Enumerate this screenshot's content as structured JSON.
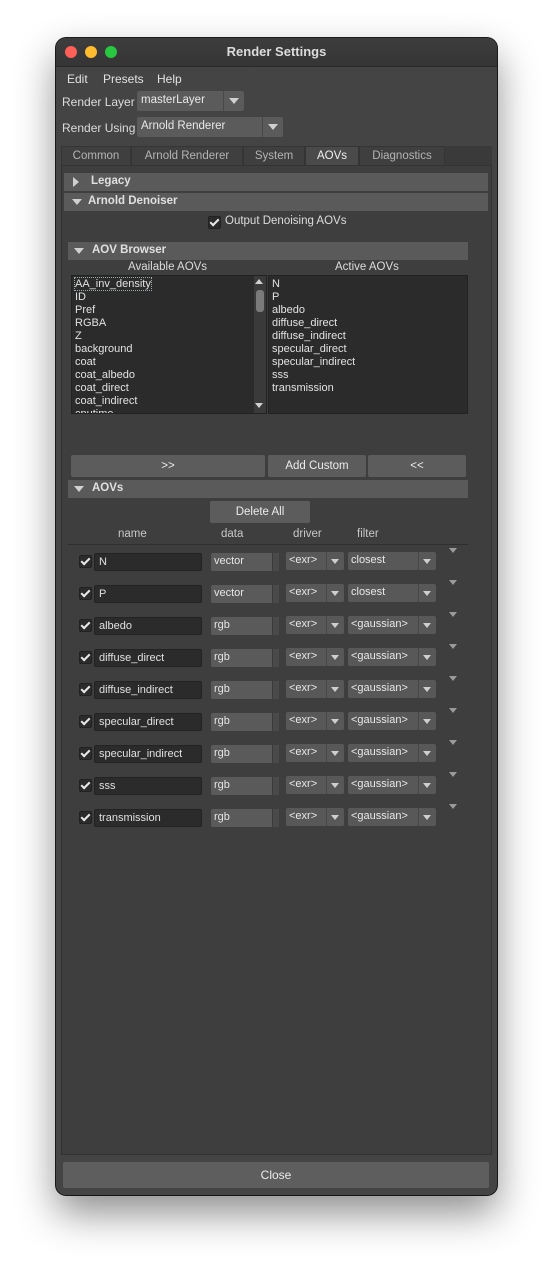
{
  "window": {
    "title": "Render Settings"
  },
  "menu": [
    "Edit",
    "Presets",
    "Help"
  ],
  "render_layer": {
    "label": "Render Layer",
    "value": "masterLayer"
  },
  "render_using": {
    "label": "Render Using",
    "value": "Arnold Renderer"
  },
  "tabs": [
    "Common",
    "Arnold Renderer",
    "System",
    "AOVs",
    "Diagnostics"
  ],
  "active_tab": "AOVs",
  "sections": {
    "legacy": "Legacy",
    "denoiser": "Arnold Denoiser",
    "denoise_check_label": "Output Denoising AOVs",
    "browser": "AOV Browser",
    "aovs": "AOVs"
  },
  "browser": {
    "available_header": "Available AOVs",
    "active_header": "Active AOVs",
    "available": [
      "AA_inv_density",
      "ID",
      "Pref",
      "RGBA",
      "Z",
      "background",
      "coat",
      "coat_albedo",
      "coat_direct",
      "coat_indirect",
      "cputime"
    ],
    "active": [
      "N",
      "P",
      "albedo",
      "diffuse_direct",
      "diffuse_indirect",
      "specular_direct",
      "specular_indirect",
      "sss",
      "transmission"
    ],
    "add_label": ">>",
    "custom_label": "Add Custom",
    "remove_label": "<<"
  },
  "aov_table": {
    "delete_all": "Delete All",
    "headers": {
      "name": "name",
      "data": "data",
      "driver": "driver",
      "filter": "filter"
    },
    "rows": [
      {
        "name": "N",
        "data": "vector",
        "driver": "<exr>",
        "filter": "closest"
      },
      {
        "name": "P",
        "data": "vector",
        "driver": "<exr>",
        "filter": "closest"
      },
      {
        "name": "albedo",
        "data": "rgb",
        "driver": "<exr>",
        "filter": "<gaussian>"
      },
      {
        "name": "diffuse_direct",
        "data": "rgb",
        "driver": "<exr>",
        "filter": "<gaussian>"
      },
      {
        "name": "diffuse_indirect",
        "data": "rgb",
        "driver": "<exr>",
        "filter": "<gaussian>"
      },
      {
        "name": "specular_direct",
        "data": "rgb",
        "driver": "<exr>",
        "filter": "<gaussian>"
      },
      {
        "name": "specular_indirect",
        "data": "rgb",
        "driver": "<exr>",
        "filter": "<gaussian>"
      },
      {
        "name": "sss",
        "data": "rgb",
        "driver": "<exr>",
        "filter": "<gaussian>"
      },
      {
        "name": "transmission",
        "data": "rgb",
        "driver": "<exr>",
        "filter": "<gaussian>"
      }
    ]
  },
  "close_label": "Close"
}
